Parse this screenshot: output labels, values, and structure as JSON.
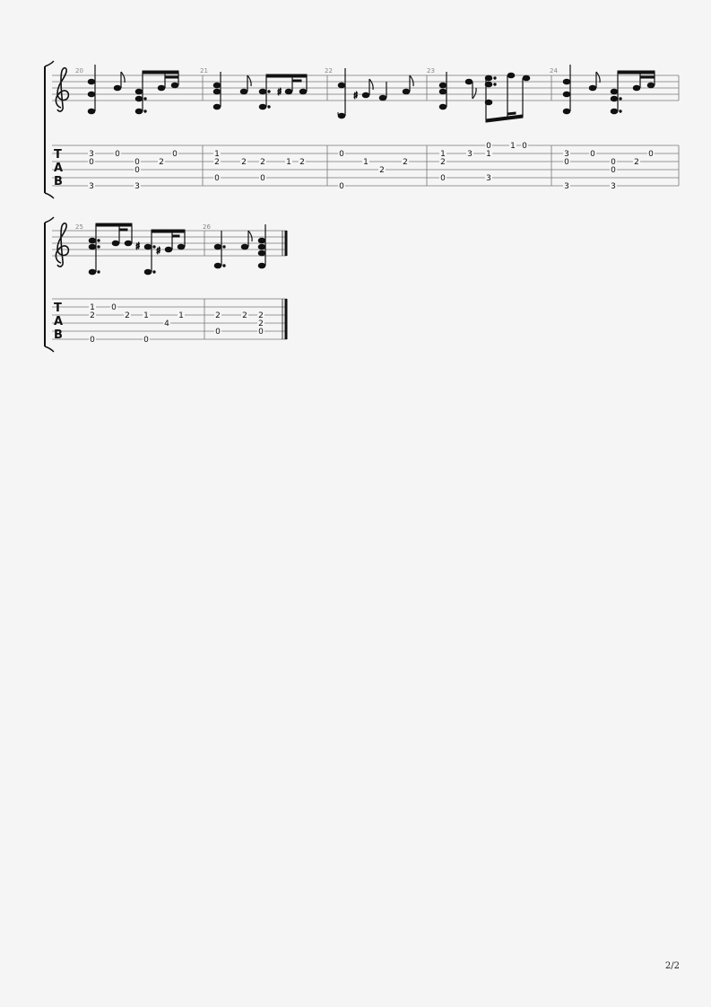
{
  "page": {
    "number_label": "2/2"
  },
  "systems": [
    {
      "measures": [
        {
          "number": "20",
          "tab": [
            {
              "string": 1,
              "fret": "3",
              "beat": 0
            },
            {
              "string": 2,
              "fret": "0",
              "beat": 0
            },
            {
              "string": 5,
              "fret": "3",
              "beat": 0
            },
            {
              "string": 1,
              "fret": "0",
              "beat": 1
            },
            {
              "string": 2,
              "fret": "0",
              "beat": 2
            },
            {
              "string": 3,
              "fret": "0",
              "beat": 2
            },
            {
              "string": 5,
              "fret": "3",
              "beat": 2
            },
            {
              "string": 2,
              "fret": "2",
              "beat": 3
            },
            {
              "string": 1,
              "fret": "0",
              "beat": 4
            }
          ]
        },
        {
          "number": "21",
          "tab": [
            {
              "string": 1,
              "fret": "1",
              "beat": 0
            },
            {
              "string": 2,
              "fret": "2",
              "beat": 0
            },
            {
              "string": 4,
              "fret": "0",
              "beat": 0
            },
            {
              "string": 2,
              "fret": "2",
              "beat": 1
            },
            {
              "string": 2,
              "fret": "2",
              "beat": 2
            },
            {
              "string": 4,
              "fret": "0",
              "beat": 2
            },
            {
              "string": 2,
              "fret": "1",
              "beat": 3
            },
            {
              "string": 2,
              "fret": "2",
              "beat": 4
            }
          ]
        },
        {
          "number": "22",
          "tab": [
            {
              "string": 1,
              "fret": "0",
              "beat": 0
            },
            {
              "string": 5,
              "fret": "0",
              "beat": 0
            },
            {
              "string": 2,
              "fret": "1",
              "beat": 1
            },
            {
              "string": 3,
              "fret": "2",
              "beat": 2
            },
            {
              "string": 2,
              "fret": "2",
              "beat": 3
            }
          ]
        },
        {
          "number": "23",
          "tab": [
            {
              "string": 1,
              "fret": "1",
              "beat": 0
            },
            {
              "string": 2,
              "fret": "2",
              "beat": 0
            },
            {
              "string": 4,
              "fret": "0",
              "beat": 0
            },
            {
              "string": 1,
              "fret": "3",
              "beat": 1
            },
            {
              "string": 0,
              "fret": "0",
              "beat": 2
            },
            {
              "string": 1,
              "fret": "1",
              "beat": 2
            },
            {
              "string": 4,
              "fret": "3",
              "beat": 2
            },
            {
              "string": 0,
              "fret": "1",
              "beat": 3
            },
            {
              "string": 0,
              "fret": "0",
              "beat": 4
            }
          ]
        },
        {
          "number": "24",
          "tab": [
            {
              "string": 1,
              "fret": "3",
              "beat": 0
            },
            {
              "string": 2,
              "fret": "0",
              "beat": 0
            },
            {
              "string": 5,
              "fret": "3",
              "beat": 0
            },
            {
              "string": 1,
              "fret": "0",
              "beat": 1
            },
            {
              "string": 2,
              "fret": "0",
              "beat": 2
            },
            {
              "string": 3,
              "fret": "0",
              "beat": 2
            },
            {
              "string": 5,
              "fret": "3",
              "beat": 2
            },
            {
              "string": 2,
              "fret": "2",
              "beat": 3
            },
            {
              "string": 1,
              "fret": "0",
              "beat": 4
            }
          ]
        }
      ]
    },
    {
      "measures": [
        {
          "number": "25",
          "tab": [
            {
              "string": 1,
              "fret": "1",
              "beat": 0
            },
            {
              "string": 2,
              "fret": "2",
              "beat": 0
            },
            {
              "string": 5,
              "fret": "0",
              "beat": 0
            },
            {
              "string": 1,
              "fret": "0",
              "beat": 1
            },
            {
              "string": 2,
              "fret": "2",
              "beat": 2
            },
            {
              "string": 2,
              "fret": "1",
              "beat": 3
            },
            {
              "string": 5,
              "fret": "0",
              "beat": 3
            },
            {
              "string": 3,
              "fret": "4",
              "beat": 4
            },
            {
              "string": 2,
              "fret": "1",
              "beat": 5
            }
          ]
        },
        {
          "number": "26",
          "tab": [
            {
              "string": 2,
              "fret": "2",
              "beat": 0
            },
            {
              "string": 4,
              "fret": "0",
              "beat": 0
            },
            {
              "string": 2,
              "fret": "2",
              "beat": 1
            },
            {
              "string": 2,
              "fret": "2",
              "beat": 2
            },
            {
              "string": 3,
              "fret": "2",
              "beat": 2
            },
            {
              "string": 4,
              "fret": "0",
              "beat": 2
            }
          ]
        }
      ]
    }
  ],
  "tab_clef": [
    "T",
    "A",
    "B"
  ]
}
